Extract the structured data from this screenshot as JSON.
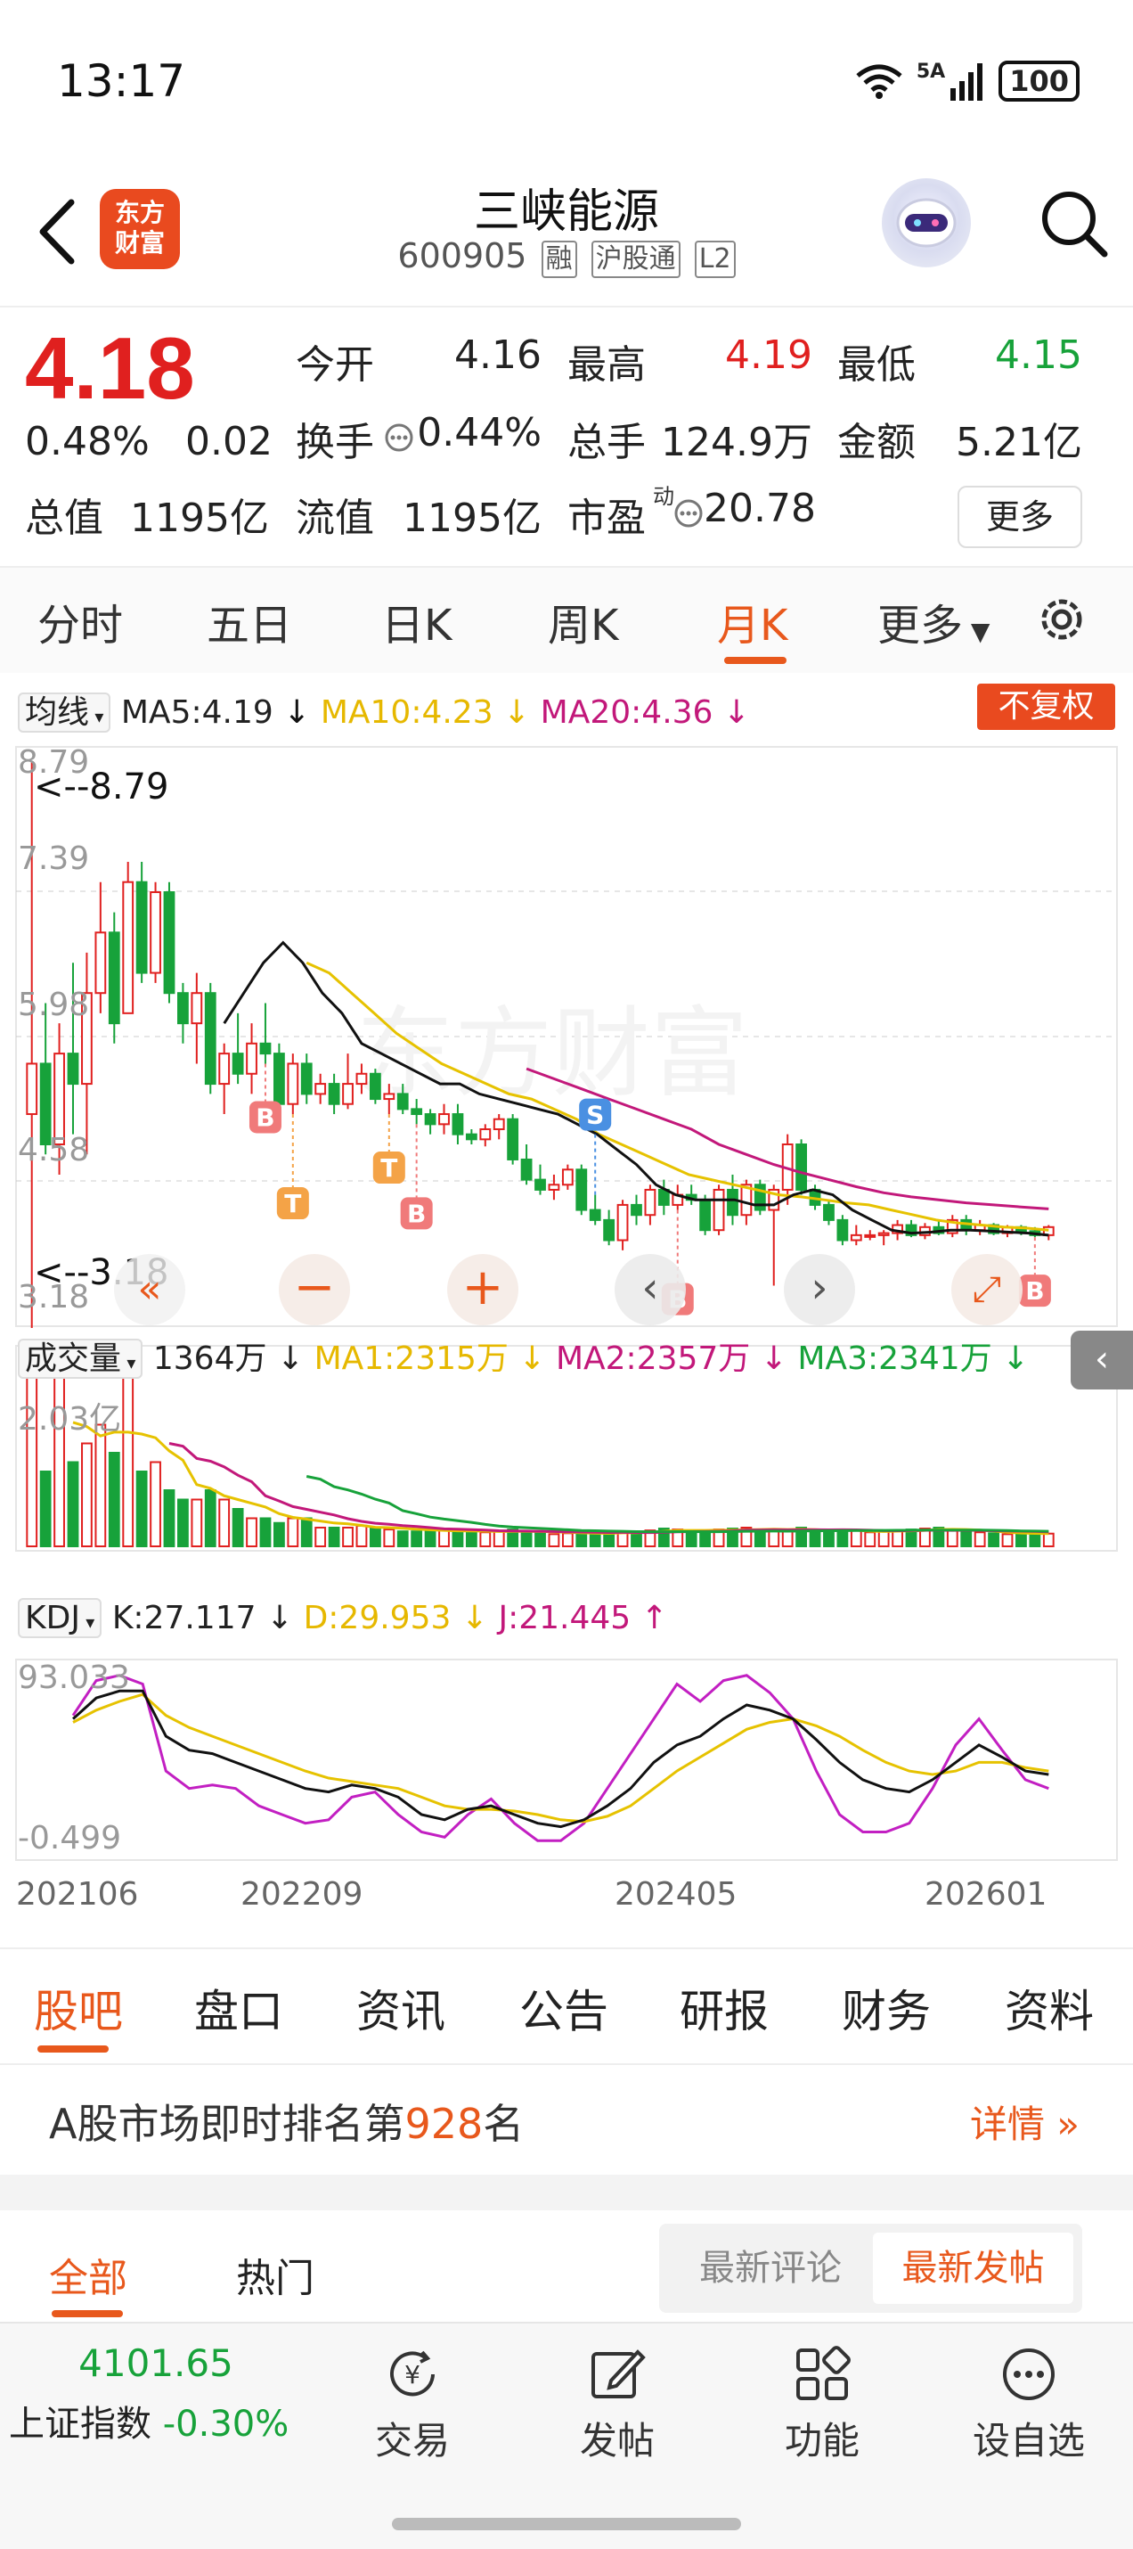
{
  "status_bar": {
    "time": "13:17",
    "network": "5A",
    "battery": "100"
  },
  "header": {
    "logo_text_1": "东方",
    "logo_text_2": "财富",
    "stock_name": "三峡能源",
    "stock_code": "600905",
    "tags": [
      "融",
      "沪股通",
      "L2"
    ]
  },
  "quote": {
    "price": "4.18",
    "change_pct": "0.48%",
    "change_abs": "0.02",
    "open_label": "今开",
    "open": "4.16",
    "high_label": "最高",
    "high": "4.19",
    "low_label": "最低",
    "low": "4.15",
    "turnover_label": "换手",
    "turnover": "0.44%",
    "volume_label": "总手",
    "volume": "124.9万",
    "amount_label": "金额",
    "amount": "5.21亿",
    "mcap_label": "总值",
    "mcap": "1195亿",
    "float_label": "流值",
    "float_cap": "1195亿",
    "pe_label": "市盈",
    "pe_sup": "动",
    "pe": "20.78",
    "more_label": "更多"
  },
  "period_tabs": [
    "分时",
    "五日",
    "日K",
    "周K",
    "月K",
    "更多"
  ],
  "period_active": "月K",
  "ma_bar": {
    "selector": "均线",
    "ma5": "MA5:4.19",
    "ma10": "MA10:4.23",
    "ma20": "MA20:4.36",
    "fuquan": "不复权"
  },
  "price_axis": {
    "labels": [
      "8.79",
      "7.39",
      "5.98",
      "4.58",
      "3.18"
    ],
    "max_marker": "<--8.79",
    "min_marker": "<--3.18"
  },
  "vol_bar": {
    "selector": "成交量",
    "vol": "1364万",
    "ma1": "MA1:2315万",
    "ma2": "MA2:2357万",
    "ma3": "MA3:2341万",
    "axis_top": "2.03亿"
  },
  "kdj_bar": {
    "selector": "KDJ",
    "k": "K:27.117",
    "d": "D:29.953",
    "j": "J:21.445",
    "axis_top": "93.033",
    "axis_bottom": "-0.499"
  },
  "x_axis": [
    "202106",
    "202209",
    "202405",
    "202601"
  ],
  "chart_data": {
    "type": "candlestick",
    "candles": [
      [
        5.3,
        8.79,
        3.18,
        5.8
      ],
      [
        5.8,
        6.4,
        4.9,
        5.0
      ],
      [
        5.0,
        6.2,
        4.7,
        5.9
      ],
      [
        5.9,
        6.8,
        5.1,
        5.6
      ],
      [
        5.6,
        6.9,
        4.9,
        6.5
      ],
      [
        6.5,
        7.6,
        6.3,
        7.1
      ],
      [
        7.1,
        7.3,
        6.0,
        6.2
      ],
      [
        6.3,
        7.8,
        6.3,
        7.6
      ],
      [
        7.6,
        7.8,
        6.6,
        6.7
      ],
      [
        6.7,
        7.6,
        6.6,
        7.5
      ],
      [
        7.5,
        7.6,
        6.4,
        6.5
      ],
      [
        6.5,
        6.6,
        6.0,
        6.2
      ],
      [
        6.2,
        6.7,
        5.8,
        6.5
      ],
      [
        6.5,
        6.6,
        5.5,
        5.6
      ],
      [
        5.6,
        6.0,
        5.3,
        5.9
      ],
      [
        5.9,
        6.3,
        5.6,
        5.7
      ],
      [
        5.7,
        6.2,
        5.5,
        6.0
      ],
      [
        6.0,
        6.4,
        5.8,
        5.9
      ],
      [
        5.9,
        6.0,
        5.2,
        5.4
      ],
      [
        5.4,
        5.9,
        5.3,
        5.8
      ],
      [
        5.8,
        5.9,
        5.4,
        5.5
      ],
      [
        5.5,
        5.7,
        5.4,
        5.6
      ],
      [
        5.6,
        5.7,
        5.3,
        5.4
      ],
      [
        5.4,
        5.9,
        5.35,
        5.6
      ],
      [
        5.6,
        5.8,
        5.5,
        5.7
      ],
      [
        5.7,
        5.75,
        5.4,
        5.45
      ],
      [
        5.45,
        5.6,
        5.3,
        5.5
      ],
      [
        5.5,
        5.6,
        5.3,
        5.35
      ],
      [
        5.35,
        5.45,
        5.2,
        5.3
      ],
      [
        5.3,
        5.35,
        5.1,
        5.2
      ],
      [
        5.2,
        5.4,
        5.1,
        5.3
      ],
      [
        5.3,
        5.4,
        5.0,
        5.1
      ],
      [
        5.1,
        5.15,
        5.0,
        5.05
      ],
      [
        5.05,
        5.2,
        4.98,
        5.15
      ],
      [
        5.15,
        5.3,
        5.05,
        5.25
      ],
      [
        5.25,
        5.3,
        4.8,
        4.85
      ],
      [
        4.85,
        5.0,
        4.6,
        4.65
      ],
      [
        4.65,
        4.8,
        4.5,
        4.55
      ],
      [
        4.55,
        4.7,
        4.45,
        4.6
      ],
      [
        4.6,
        4.8,
        4.55,
        4.75
      ],
      [
        4.75,
        4.8,
        4.3,
        4.35
      ],
      [
        4.35,
        4.5,
        4.2,
        4.25
      ],
      [
        4.25,
        4.35,
        4.0,
        4.05
      ],
      [
        4.05,
        4.45,
        3.95,
        4.4
      ],
      [
        4.4,
        4.5,
        4.2,
        4.3
      ],
      [
        4.3,
        4.6,
        4.2,
        4.55
      ],
      [
        4.55,
        4.65,
        4.3,
        4.4
      ],
      [
        4.4,
        4.6,
        4.35,
        4.5
      ],
      [
        4.5,
        4.6,
        4.4,
        4.45
      ],
      [
        4.45,
        4.5,
        4.1,
        4.15
      ],
      [
        4.15,
        4.6,
        4.1,
        4.55
      ],
      [
        4.55,
        4.7,
        4.2,
        4.3
      ],
      [
        4.3,
        4.65,
        4.2,
        4.6
      ],
      [
        4.6,
        4.65,
        4.3,
        4.35
      ],
      [
        4.35,
        4.6,
        3.6,
        4.55
      ],
      [
        4.55,
        5.1,
        4.4,
        5.0
      ],
      [
        5.0,
        5.05,
        4.5,
        4.55
      ],
      [
        4.55,
        4.6,
        4.35,
        4.4
      ],
      [
        4.4,
        4.45,
        4.2,
        4.25
      ],
      [
        4.25,
        4.3,
        4.0,
        4.05
      ],
      [
        4.05,
        4.2,
        4.0,
        4.1
      ],
      [
        4.1,
        4.15,
        4.05,
        4.1
      ],
      [
        4.1,
        4.15,
        4.0,
        4.12
      ],
      [
        4.12,
        4.25,
        4.05,
        4.2
      ],
      [
        4.2,
        4.25,
        4.08,
        4.1
      ],
      [
        4.1,
        4.22,
        4.06,
        4.18
      ],
      [
        4.18,
        4.25,
        4.1,
        4.12
      ],
      [
        4.12,
        4.3,
        4.08,
        4.25
      ],
      [
        4.25,
        4.3,
        4.1,
        4.15
      ],
      [
        4.15,
        4.25,
        4.1,
        4.2
      ],
      [
        4.2,
        4.22,
        4.1,
        4.12
      ],
      [
        4.12,
        4.2,
        4.08,
        4.18
      ],
      [
        4.18,
        4.2,
        4.1,
        4.14
      ],
      [
        4.14,
        4.18,
        4.08,
        4.1
      ],
      [
        4.1,
        4.2,
        4.05,
        4.18
      ]
    ],
    "ma5_series": [
      6.2,
      6.5,
      6.8,
      7.0,
      6.8,
      6.5,
      6.3,
      6.0,
      5.9,
      5.8,
      5.7,
      5.6,
      5.6,
      5.5,
      5.45,
      5.4,
      5.35,
      5.3,
      5.2,
      5.1,
      4.95,
      4.8,
      4.6,
      4.5,
      4.45,
      4.45,
      4.45,
      4.4,
      4.4,
      4.5,
      4.55,
      4.5,
      4.35,
      4.25,
      4.15,
      4.12,
      4.13,
      4.15,
      4.15,
      4.14,
      4.13,
      4.12,
      4.1
    ],
    "ma10_series": [
      6.8,
      6.7,
      6.5,
      6.3,
      6.1,
      5.95,
      5.8,
      5.7,
      5.6,
      5.5,
      5.45,
      5.35,
      5.25,
      5.1,
      5.0,
      4.9,
      4.8,
      4.7,
      4.65,
      4.6,
      4.55,
      4.5,
      4.48,
      4.45,
      4.42,
      4.4,
      4.35,
      4.3,
      4.25,
      4.22,
      4.2,
      4.18,
      4.17,
      4.15
    ],
    "ma20_series": [
      5.75,
      5.65,
      5.55,
      5.45,
      5.35,
      5.25,
      5.15,
      5.0,
      4.9,
      4.8,
      4.72,
      4.65,
      4.58,
      4.52,
      4.48,
      4.45,
      4.42,
      4.4,
      4.38,
      4.36
    ],
    "markers": [
      {
        "label": "B",
        "type": "buy"
      },
      {
        "label": "T",
        "type": "t"
      },
      {
        "label": "T",
        "type": "t"
      },
      {
        "label": "B",
        "type": "buy"
      },
      {
        "label": "S",
        "type": "sell"
      },
      {
        "label": "B",
        "type": "buy"
      },
      {
        "label": "B",
        "type": "buy"
      }
    ],
    "volume": [
      18,
      8,
      18,
      9,
      11,
      13,
      10,
      18,
      8,
      9,
      6,
      5,
      5,
      6,
      5,
      4,
      3,
      3,
      2.5,
      3,
      3,
      2,
      2,
      2,
      2.2,
      2,
      1.8,
      1.6,
      1.6,
      1.8,
      1.7,
      1.6,
      1.5,
      1.5,
      1.6,
      1.8,
      1.6,
      1.4,
      1.3,
      1.4,
      1.5,
      1.4,
      1.3,
      1.6,
      1.5,
      1.7,
      1.9,
      1.8,
      1.6,
      1.5,
      1.8,
      1.9,
      2.0,
      1.8,
      1.7,
      1.6,
      2.0,
      1.8,
      1.5,
      1.6,
      1.7,
      1.5,
      1.6,
      1.7,
      1.8,
      1.9,
      2.0,
      1.7,
      1.6,
      1.5,
      1.4,
      1.3,
      1.3,
      1.4,
      1.36
    ],
    "k_series": [
      70,
      82,
      86,
      86,
      60,
      52,
      50,
      45,
      40,
      35,
      30,
      28,
      32,
      30,
      25,
      15,
      12,
      18,
      20,
      15,
      10,
      8,
      12,
      20,
      30,
      45,
      55,
      60,
      70,
      78,
      75,
      70,
      58,
      45,
      35,
      30,
      28,
      35,
      45,
      55,
      48,
      40,
      38
    ],
    "d_series": [
      68,
      75,
      80,
      84,
      72,
      65,
      60,
      55,
      50,
      45,
      40,
      36,
      34,
      32,
      30,
      25,
      20,
      18,
      18,
      17,
      15,
      12,
      11,
      14,
      20,
      30,
      40,
      48,
      56,
      64,
      68,
      70,
      66,
      60,
      52,
      45,
      40,
      38,
      40,
      45,
      45,
      42,
      40
    ],
    "j_series": [
      72,
      92,
      95,
      90,
      40,
      30,
      32,
      30,
      20,
      15,
      10,
      12,
      25,
      28,
      15,
      5,
      2,
      15,
      24,
      10,
      0,
      0,
      10,
      30,
      50,
      70,
      90,
      80,
      92,
      95,
      85,
      70,
      40,
      15,
      5,
      5,
      10,
      30,
      55,
      70,
      52,
      35,
      30
    ]
  },
  "section_tabs": [
    "股吧",
    "盘口",
    "资讯",
    "公告",
    "研报",
    "财务",
    "资料"
  ],
  "rank": {
    "prefix": "A股市场即时排名第",
    "number": "928",
    "suffix": "名",
    "detail": "详情"
  },
  "feed_tabs": [
    "全部",
    "热门"
  ],
  "sort_options": [
    "最新评论",
    "最新发帖"
  ],
  "bottom_bar": {
    "index_value": "4101.65",
    "index_name": "上证指数",
    "index_change": "-0.30%",
    "nav": [
      "交易",
      "发帖",
      "功能",
      "设自选"
    ]
  },
  "colors": {
    "up": "#e0201f",
    "down": "#17a23a",
    "accent": "#e8581c",
    "ma5": "#111111",
    "ma10": "#e6b800",
    "ma20": "#c2187a"
  }
}
